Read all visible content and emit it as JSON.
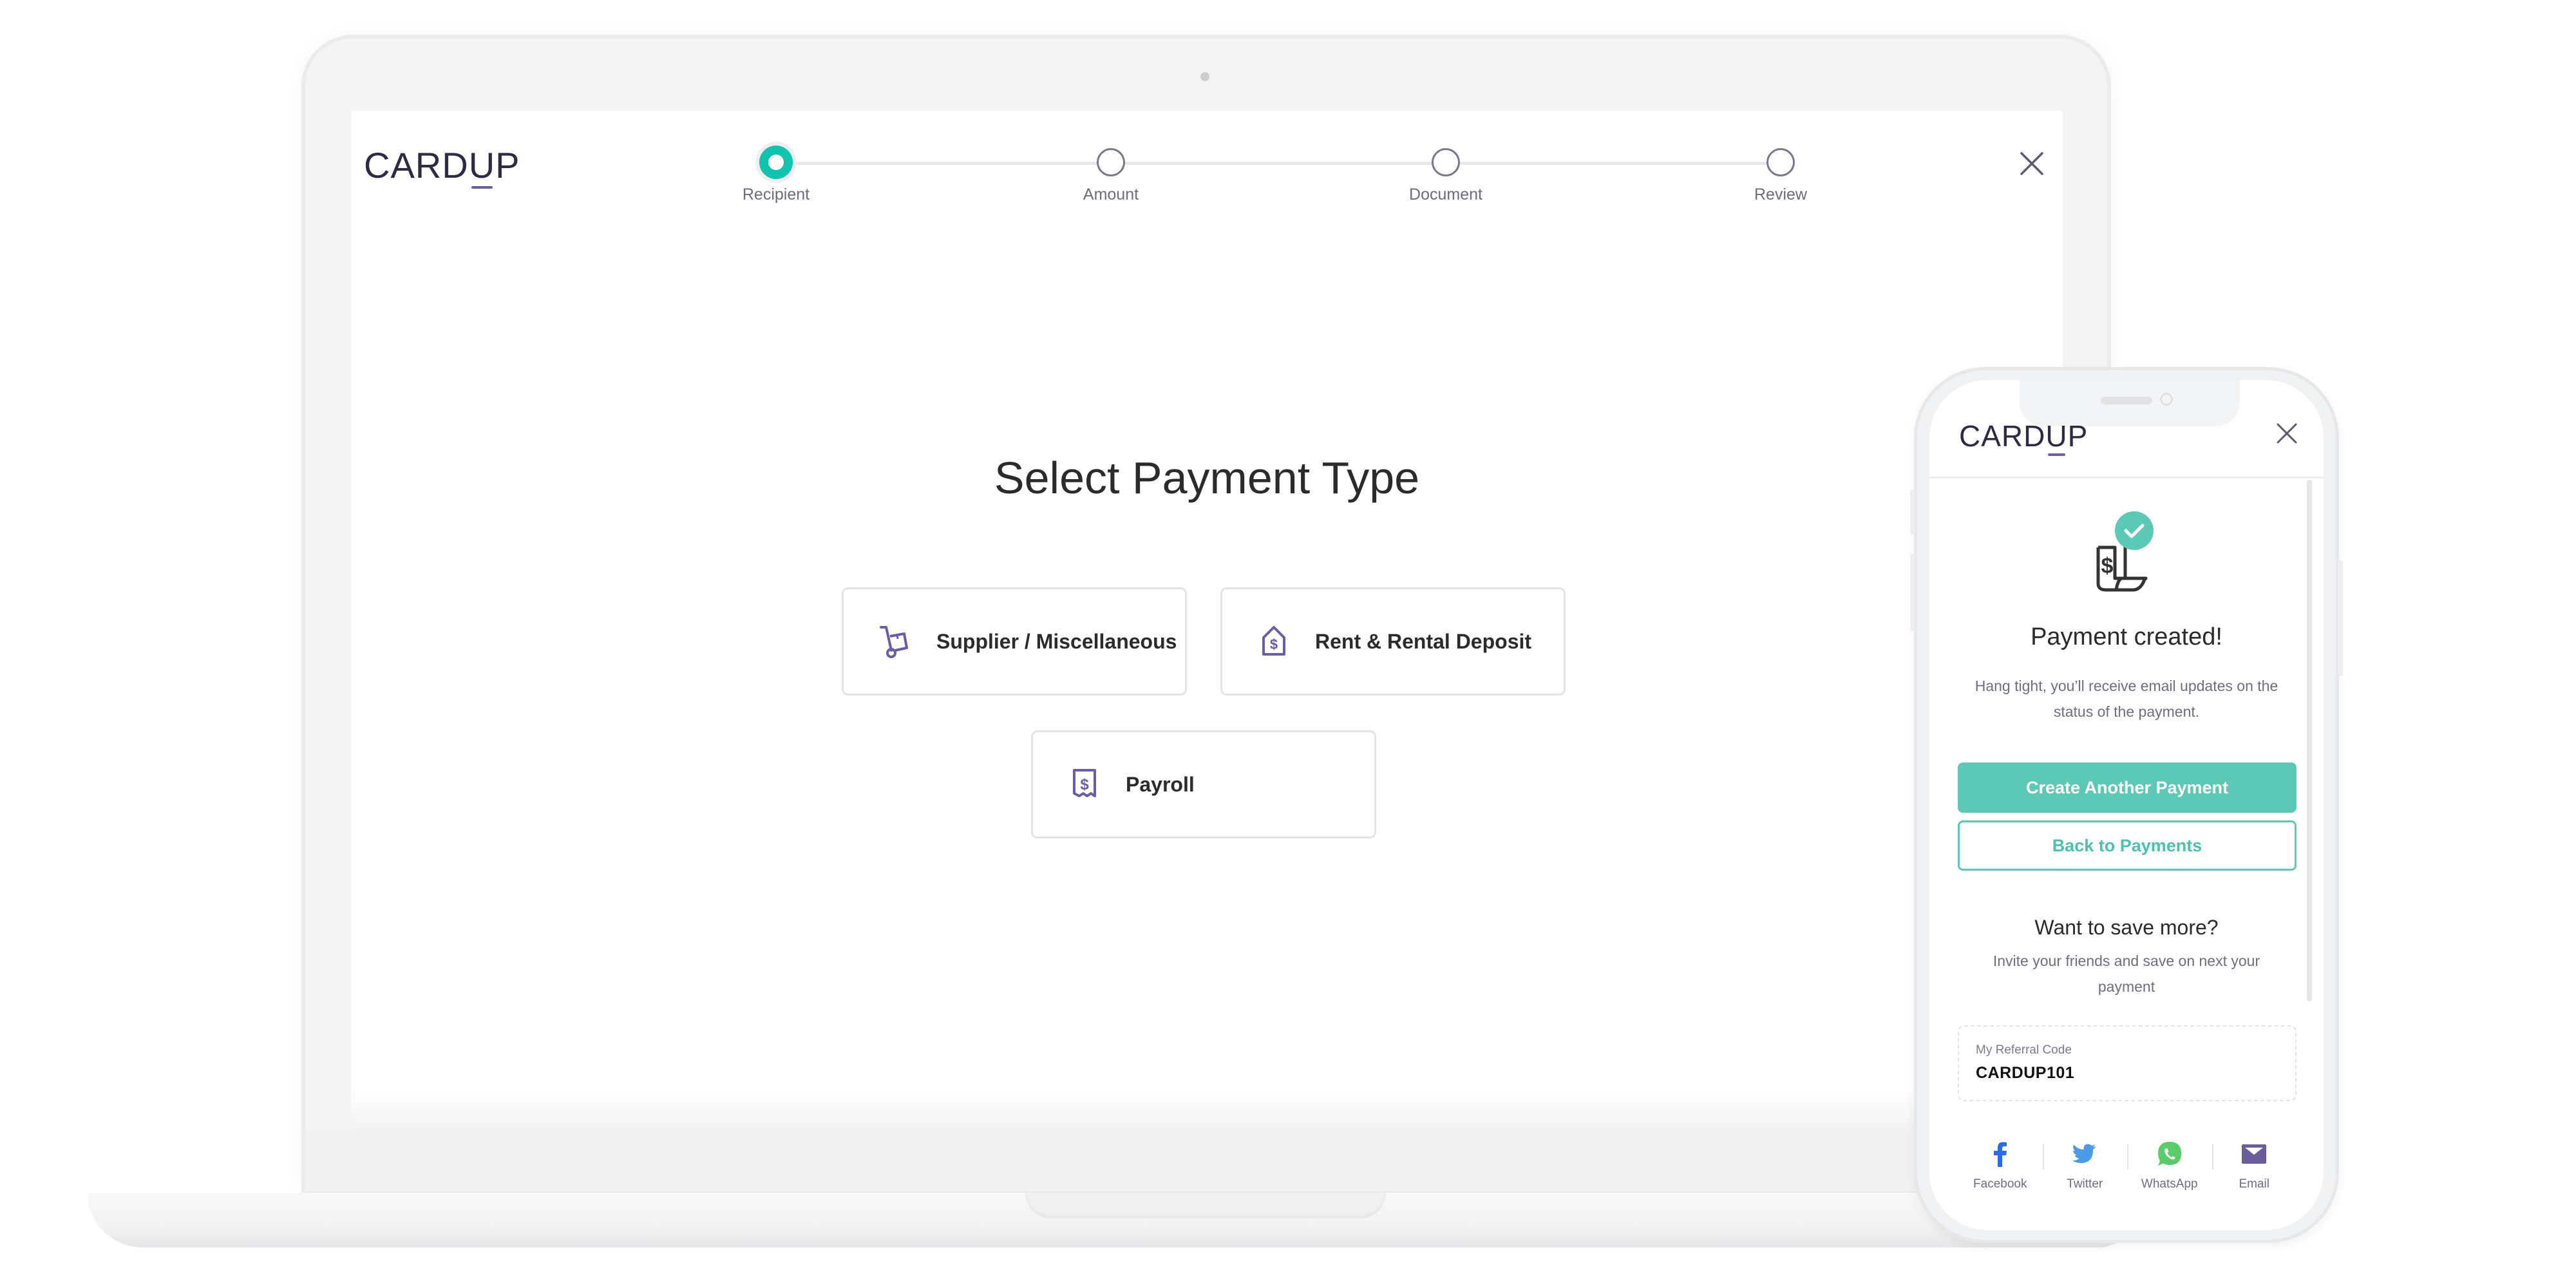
{
  "desktop": {
    "brand": {
      "text_before": "CARD",
      "text_u": "U",
      "text_after": "P"
    },
    "stepper": {
      "steps": [
        {
          "label": "Recipient",
          "state": "active"
        },
        {
          "label": "Amount",
          "state": "inactive"
        },
        {
          "label": "Document",
          "state": "inactive"
        },
        {
          "label": "Review",
          "state": "inactive"
        }
      ]
    },
    "close_icon": "close-icon",
    "title": "Select Payment Type",
    "payment_types": [
      {
        "label": "Supplier / Miscellaneous",
        "icon": "hand-truck-icon"
      },
      {
        "label": "Rent & Rental Deposit",
        "icon": "house-dollar-icon"
      },
      {
        "label": "Payroll",
        "icon": "receipt-dollar-icon"
      }
    ]
  },
  "mobile": {
    "brand": {
      "text_before": "CARD",
      "text_u": "U",
      "text_after": "P"
    },
    "close_icon": "close-icon",
    "success_icon": "receipt-check-icon",
    "title": "Payment created!",
    "description": "Hang tight, you’ll receive email updates on the status of the payment.",
    "primary_button": "Create Another Payment",
    "secondary_button": "Back to Payments",
    "referral": {
      "heading": "Want to save more?",
      "description": "Invite your friends and save on next your payment",
      "code_label": "My Referral Code",
      "code_value": "CARDUP101"
    },
    "share": [
      {
        "label": "Facebook",
        "icon": "facebook-icon",
        "color": "#2d6be4"
      },
      {
        "label": "Twitter",
        "icon": "twitter-icon",
        "color": "#4a9be8"
      },
      {
        "label": "WhatsApp",
        "icon": "whatsapp-icon",
        "color": "#5ccb6a"
      },
      {
        "label": "Email",
        "icon": "email-icon",
        "color": "#6b5c9c"
      }
    ]
  },
  "colors": {
    "accent_teal": "#12c4ad",
    "button_teal": "#5cc8b6",
    "brand_purple": "#6b5ca5",
    "text_dark": "#2b2b2b",
    "text_muted": "#6d6e80"
  }
}
